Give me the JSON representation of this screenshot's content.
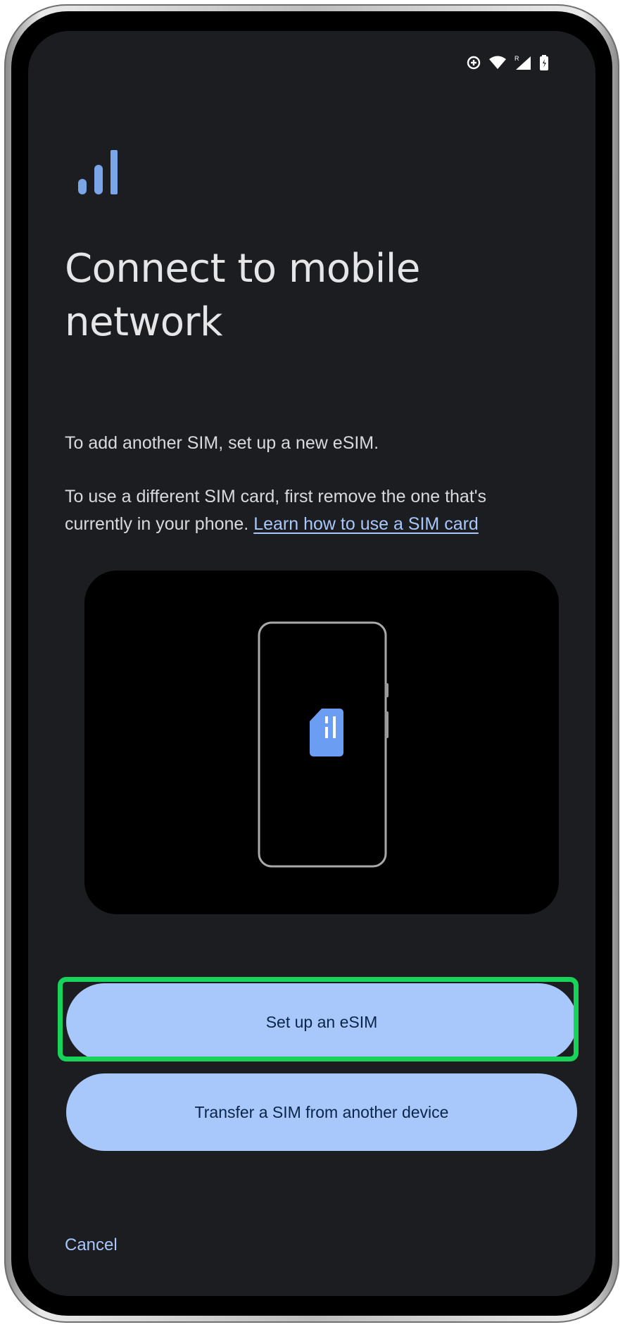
{
  "status_bar": {
    "icons": [
      "data-saver-icon",
      "wifi-icon",
      "cell-signal-roaming-icon",
      "battery-icon"
    ],
    "roaming_indicator": "R"
  },
  "header": {
    "icon": "signal-bars-icon",
    "title": "Connect to mobile network"
  },
  "body": {
    "paragraph_1": "To add another SIM, set up a new eSIM.",
    "paragraph_2": "To use a different SIM card, first remove the one that's currently in your phone.",
    "learn_link": "Learn how to use a SIM card"
  },
  "illustration": {
    "icon": "sim-card-icon"
  },
  "actions": {
    "setup_esim": "Set up an eSIM",
    "transfer_sim": "Transfer a SIM from another device",
    "cancel": "Cancel"
  },
  "colors": {
    "background": "#1c1d21",
    "accent": "#a8c7fa",
    "button_text": "#0b2548",
    "highlight": "#18d35a",
    "sim_icon": "#6b9ef2"
  }
}
